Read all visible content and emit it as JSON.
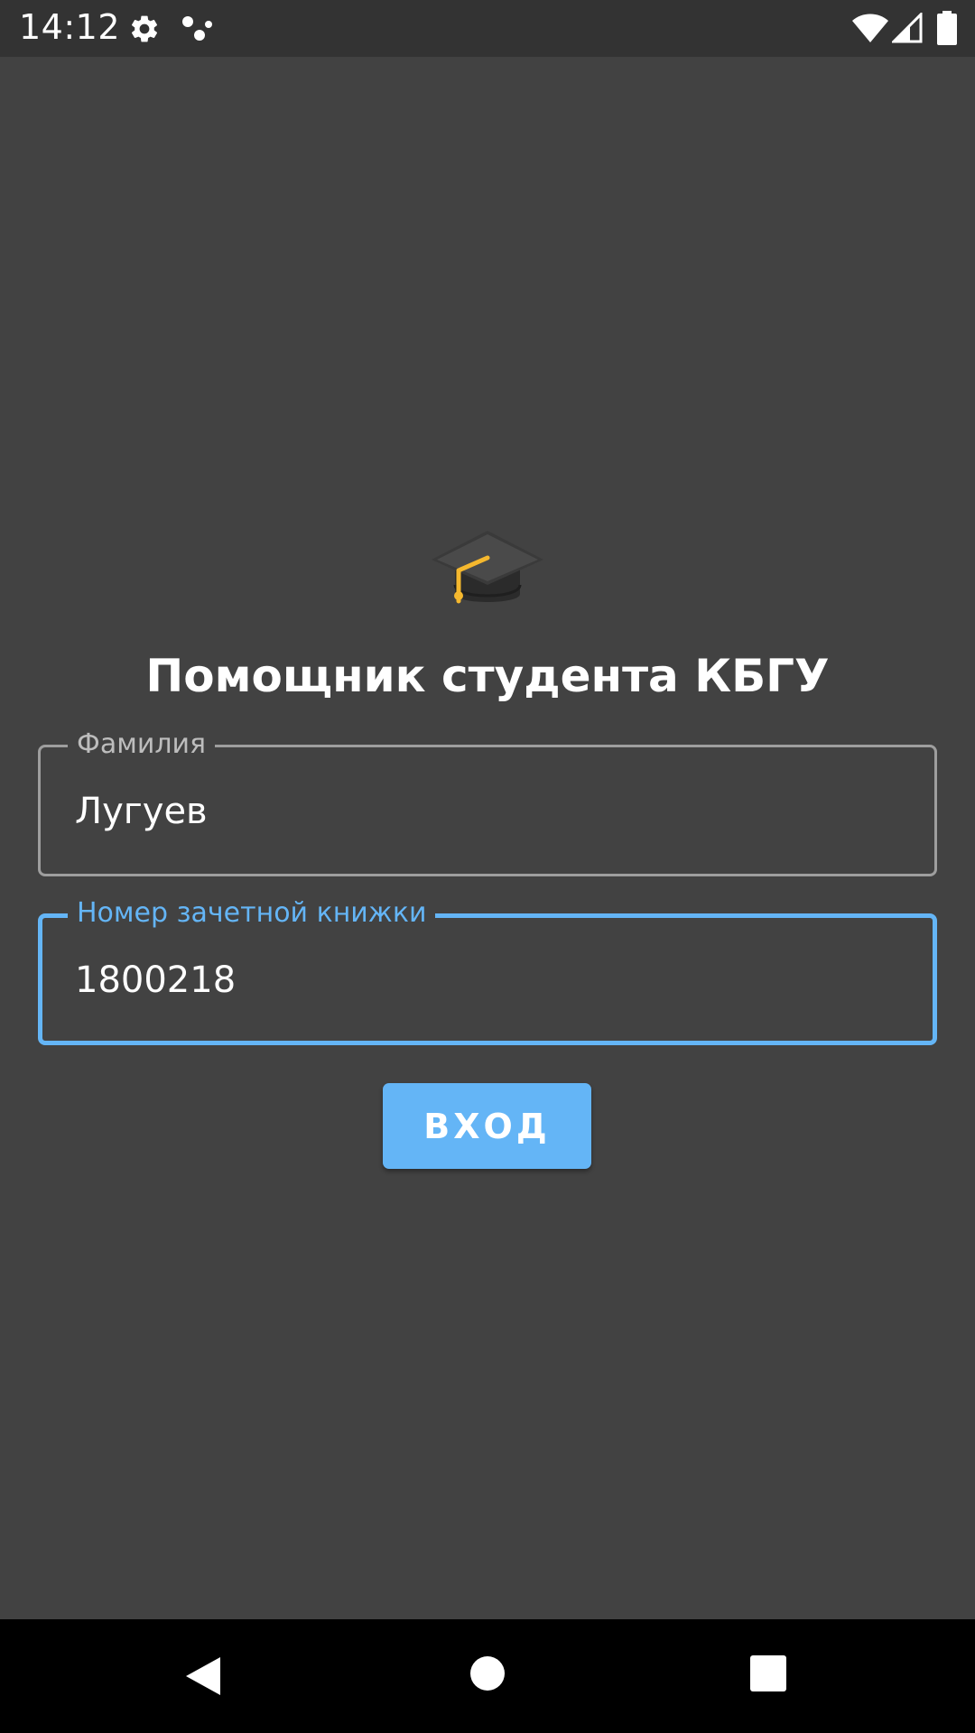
{
  "status_bar": {
    "time": "14:12",
    "icons": [
      "gear-icon",
      "assistant-dots-icon",
      "wifi-icon",
      "signal-icon",
      "battery-icon"
    ]
  },
  "app": {
    "logo_icon": "graduation-cap-icon",
    "title": "Помощник студента КБГУ"
  },
  "form": {
    "surname": {
      "label": "Фамилия",
      "value": "Лугуев"
    },
    "record_book": {
      "label": "Номер зачетной книжки",
      "value": "1800218"
    },
    "login_label": "ВХОД"
  },
  "nav_bar": {
    "buttons": [
      "back-icon",
      "home-icon",
      "recents-icon"
    ]
  },
  "colors": {
    "background": "#424242",
    "status_bar": "#333333",
    "accent": "#64b5f6",
    "nav_bar": "#000000"
  }
}
